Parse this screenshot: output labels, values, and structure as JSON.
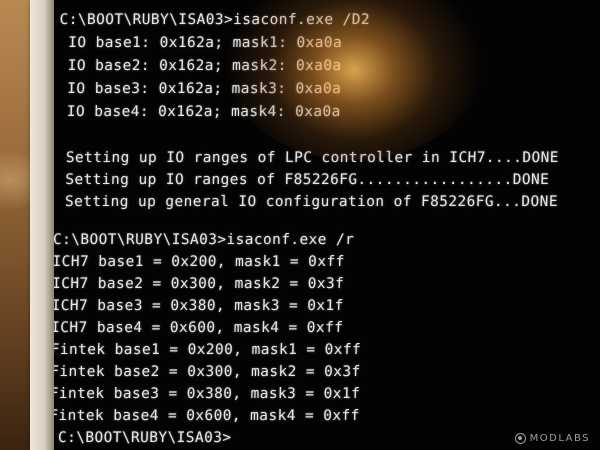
{
  "terminal": {
    "lines": [
      "C:\\BOOT\\RUBY\\ISA03>isaconf.exe /D2",
      " IO base1: 0x162a; mask1: 0xa0a",
      " IO base2: 0x162a; mask2: 0xa0a",
      " IO base3: 0x162a; mask3: 0xa0a",
      " IO base4: 0x162a; mask4: 0xa0a",
      "",
      " Setting up IO ranges of LPC controller in ICH7....DONE",
      " Setting up IO ranges of F85226FG.................DONE",
      " Setting up general IO configuration of F85226FG...DONE",
      "",
      "C:\\BOOT\\RUBY\\ISA03>isaconf.exe /r",
      "ICH7 base1 = 0x200, mask1 = 0xff",
      "ICH7 base2 = 0x300, mask2 = 0x3f",
      "ICH7 base3 = 0x380, mask3 = 0x1f",
      "ICH7 base4 = 0x600, mask4 = 0xff",
      "Fintek base1 = 0x200, mask1 = 0xff",
      "Fintek base2 = 0x300, mask2 = 0x3f",
      "Fintek base3 = 0x380, mask3 = 0x1f",
      "Fintek base4 = 0x600, mask4 = 0xff",
      "",
      " C:\\BOOT\\RUBY\\ISA03>"
    ]
  },
  "watermark": {
    "text": "MODLABS"
  },
  "colors": {
    "text": "#e6e6e6",
    "screen": "#030303",
    "glare": "#ffbe5a"
  }
}
